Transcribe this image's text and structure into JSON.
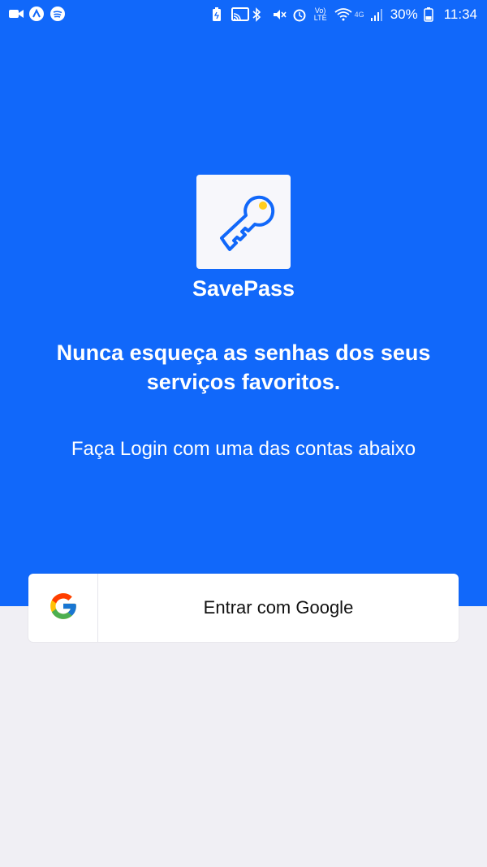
{
  "status_bar": {
    "left_icons": [
      "video-icon",
      "app-icon",
      "spotify-icon"
    ],
    "right_icons": [
      "battery-saver-icon",
      "cast-icon",
      "bluetooth-icon",
      "mute-icon",
      "alarm-icon",
      "volte-icon",
      "wifi-icon",
      "signal-icon"
    ],
    "volte_label": "Vo) LTE",
    "network_label": "4G",
    "battery": "30%",
    "time": "11:34"
  },
  "app": {
    "name": "SavePass",
    "logo_icon": "key-icon",
    "tagline": "Nunca esqueça as senhas dos seus serviços favoritos.",
    "subtitle": "Faça Login com uma das contas abaixo"
  },
  "login": {
    "google_icon": "google-icon",
    "google_label": "Entrar com Google"
  },
  "colors": {
    "primary": "#1168fa",
    "background": "#f0eff4",
    "key_accent": "#ffcd1e"
  }
}
